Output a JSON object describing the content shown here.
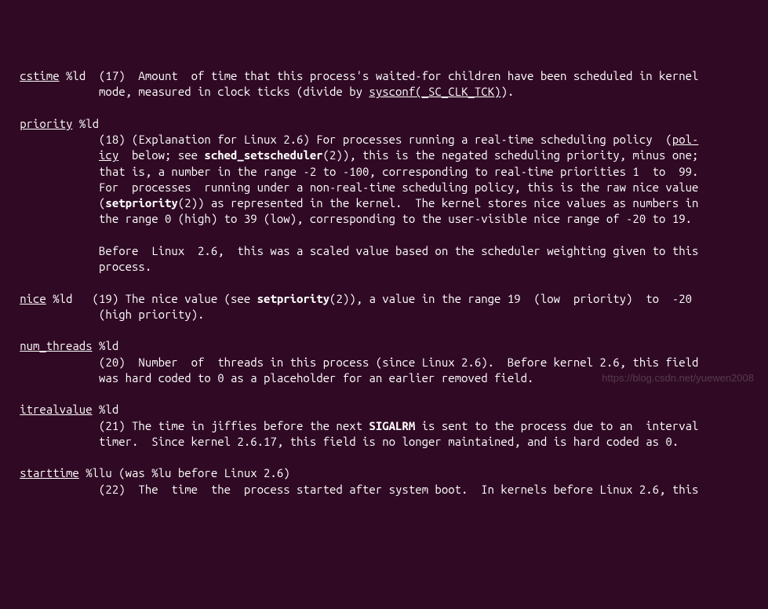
{
  "entries": {
    "cstime": {
      "name": "cstime",
      "type": "%ld",
      "line1": "(17)  Amount  of time that this process's waited-for children have been scheduled in kernel",
      "line2": "mode, measured in clock ticks (divide by ",
      "sysconf": "sysconf(_SC_CLK_TCK)",
      "line2_end": ")."
    },
    "priority": {
      "name": "priority",
      "type": "%ld",
      "l1a": "(18) (Explanation for Linux 2.6) For processes running a real-time scheduling policy  (",
      "pol": "pol-",
      "l2a": "icy",
      "l2b": "  below; see ",
      "sched": "sched_setscheduler",
      "l2c": "(2)), this is the negated scheduling priority, minus one;",
      "l3": "that is, a number in the range -2 to -100, corresponding to real-time priorities 1  to  99.",
      "l4": "For  processes  running under a non-real-time scheduling policy, this is the raw nice value",
      "l5a": "(",
      "setp": "setpriority",
      "l5b": "(2)) as represented in the kernel.  The kernel stores nice values as numbers in",
      "l6": "the range 0 (high) to 39 (low), corresponding to the user-visible nice range of -20 to 19.",
      "l7": "Before  Linux  2.6,  this was a scaled value based on the scheduler weighting given to this",
      "l8": "process."
    },
    "nice": {
      "name": "nice",
      "type": "%ld",
      "l1a": "(19) The nice value (see ",
      "setp": "setpriority",
      "l1b": "(2)), a value in the range 19  (low  priority)  to  -20",
      "l2": "(high priority)."
    },
    "num_threads": {
      "name": "num_threads",
      "type": "%ld",
      "l1": "(20)  Number  of  threads in this process (since Linux 2.6).  Before kernel 2.6, this field",
      "l2": "was hard coded to 0 as a placeholder for an earlier removed field."
    },
    "itrealvalue": {
      "name": "itrealvalue",
      "type": "%ld",
      "l1a": "(21) The time in jiffies before the next ",
      "sig": "SIGALRM",
      "l1b": " is sent to the process due to an  interval",
      "l2": "timer.  Since kernel 2.6.17, this field is no longer maintained, and is hard coded as 0."
    },
    "starttime": {
      "name": "starttime",
      "type": "%llu (was %lu before Linux 2.6)",
      "l1": "(22)  The  time  the  process started after system boot.  In kernels before Linux 2.6, this"
    }
  },
  "watermark": "https://blog.csdn.net/yuewen2008"
}
